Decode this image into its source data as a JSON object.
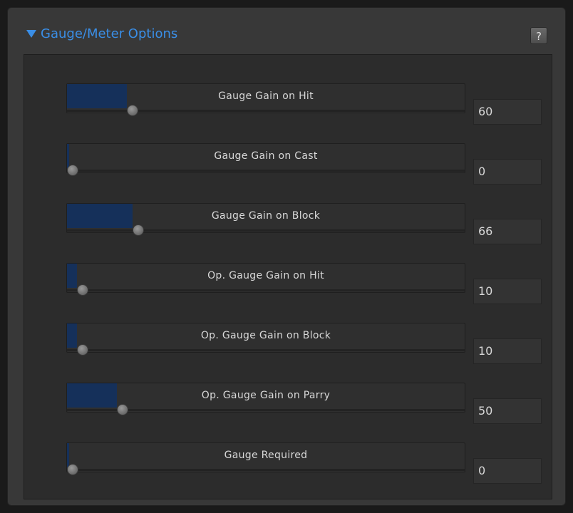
{
  "header": {
    "title": "Gauge/Meter Options",
    "help_label": "?"
  },
  "sliders": [
    {
      "label": "Gauge Gain on Hit",
      "value": "60",
      "fraction": 0.15
    },
    {
      "label": "Gauge Gain on Cast",
      "value": "0",
      "fraction": 0.0
    },
    {
      "label": "Gauge Gain on Block",
      "value": "66",
      "fraction": 0.165
    },
    {
      "label": "Op. Gauge Gain on Hit",
      "value": "10",
      "fraction": 0.025
    },
    {
      "label": "Op. Gauge Gain on Block",
      "value": "10",
      "fraction": 0.025
    },
    {
      "label": "Op. Gauge Gain on Parry",
      "value": "50",
      "fraction": 0.125
    },
    {
      "label": "Gauge Required",
      "value": "0",
      "fraction": 0.0
    }
  ],
  "colors": {
    "accent": "#3a8ee6",
    "fill": "#15305a",
    "panel": "#383838"
  }
}
